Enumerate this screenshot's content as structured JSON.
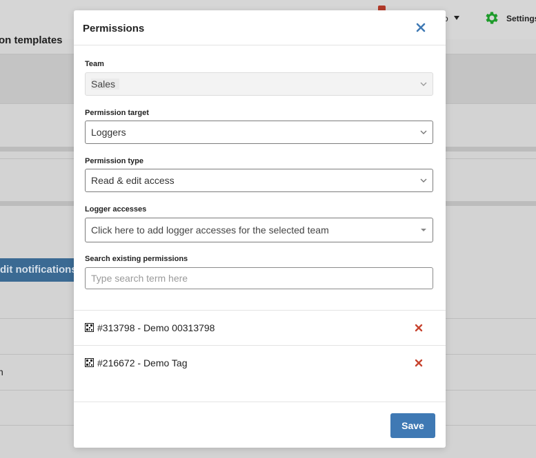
{
  "background": {
    "heading": "on templates",
    "edit_button": "dit notifications",
    "row_text": "n",
    "header_fragment": "o",
    "settings_label": "Settings"
  },
  "modal": {
    "title": "Permissions",
    "team": {
      "label": "Team",
      "value": "Sales"
    },
    "permission_target": {
      "label": "Permission target",
      "value": "Loggers"
    },
    "permission_type": {
      "label": "Permission type",
      "value": "Read & edit access"
    },
    "logger_accesses": {
      "label": "Logger accesses",
      "placeholder": "Click here to add logger accesses for the selected team"
    },
    "search": {
      "label": "Search existing permissions",
      "placeholder": "Type search term here",
      "value": ""
    },
    "permissions": [
      {
        "text": "#313798 - Demo 00313798"
      },
      {
        "text": "#216672 - Demo Tag"
      }
    ],
    "save_label": "Save"
  },
  "colors": {
    "accent": "#3f79b4",
    "close_icon": "#3f79b4",
    "remove_icon": "#c7432f",
    "settings_gear": "#1e9b2b"
  },
  "icons": {
    "close": "close-x-icon",
    "remove": "remove-x-icon",
    "logger": "qr-code-icon",
    "chevron": "chevron-down-icon",
    "settings": "gear-icon"
  }
}
